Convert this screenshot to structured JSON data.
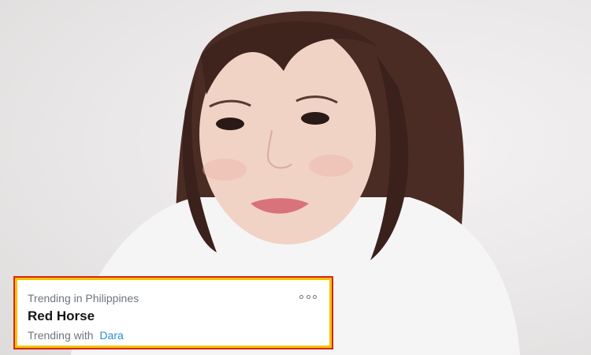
{
  "photo": {
    "description_icon": "portrait-photo"
  },
  "trend_card": {
    "context": "Trending in Philippines",
    "title": "Red Horse",
    "with_label": "Trending with",
    "with_name": "Dara",
    "more_icon": "more-options-icon",
    "colors": {
      "border_outer": "#d7261b",
      "border_inner": "#f5c400",
      "link": "#2b8fd1",
      "muted": "#6d757d",
      "title": "#141619"
    }
  }
}
